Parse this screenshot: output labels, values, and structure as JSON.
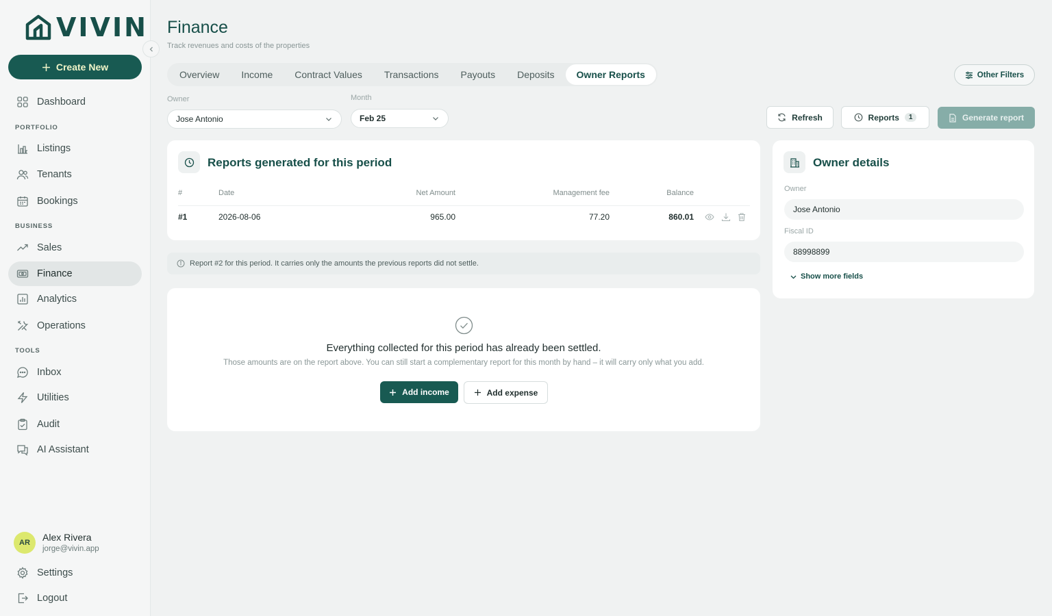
{
  "brand": {
    "name": "VIVIN",
    "colors": {
      "primary": "#185a52",
      "accent": "#dce86e",
      "background": "#f0f2f2"
    }
  },
  "sidebar": {
    "create_label": "Create New",
    "sections": {
      "portfolio": "PORTFOLIO",
      "business": "BUSINESS",
      "tools": "TOOLS"
    },
    "items": {
      "dashboard": "Dashboard",
      "listings": "Listings",
      "tenants": "Tenants",
      "bookings": "Bookings",
      "sales": "Sales",
      "finance": "Finance",
      "analytics": "Analytics",
      "operations": "Operations",
      "inbox": "Inbox",
      "utilities": "Utilities",
      "audit": "Audit",
      "ai_assistant": "AI Assistant"
    },
    "active": "finance",
    "user": {
      "initials": "AR",
      "name": "Alex Rivera",
      "email": "jorge@vivin.app"
    },
    "settings": "Settings",
    "logout": "Logout"
  },
  "header": {
    "title": "Finance",
    "subtitle": "Track revenues and costs of the properties"
  },
  "tabs": [
    {
      "label": "Overview",
      "active": false
    },
    {
      "label": "Income",
      "active": false
    },
    {
      "label": "Contract Values",
      "active": false
    },
    {
      "label": "Transactions",
      "active": false
    },
    {
      "label": "Payouts",
      "active": false
    },
    {
      "label": "Deposits",
      "active": false
    },
    {
      "label": "Owner Reports",
      "active": true
    }
  ],
  "filters": {
    "other_filters": "Other Filters",
    "owner_label": "Owner",
    "owner_value": "Jose Antonio",
    "month_label": "Month",
    "month_value": "Feb 25"
  },
  "actions": {
    "refresh": "Refresh",
    "reports": "Reports",
    "reports_count": "1",
    "generate": "Generate report"
  },
  "reports_card": {
    "title": "Reports generated for this period",
    "columns": {
      "num": "#",
      "date": "Date",
      "net_amount": "Net Amount",
      "management_fee": "Management fee",
      "balance": "Balance"
    },
    "rows": [
      {
        "num": "#1",
        "date": "2026-08-06",
        "net_amount": "965.00",
        "management_fee": "77.20",
        "balance": "860.01"
      }
    ]
  },
  "info_bar": "Report #2 for this period. It carries only the amounts the previous reports did not settle.",
  "empty_state": {
    "title": "Everything collected for this period has already been settled.",
    "subtitle": "Those amounts are on the report above. You can still start a complementary report for this month by hand – it will carry only what you add.",
    "add_income": "Add income",
    "add_expense": "Add expense"
  },
  "owner_details": {
    "title": "Owner details",
    "owner_label": "Owner",
    "owner_value": "Jose Antonio",
    "fiscal_label": "Fiscal ID",
    "fiscal_value": "88998899",
    "show_more": "Show more fields"
  }
}
